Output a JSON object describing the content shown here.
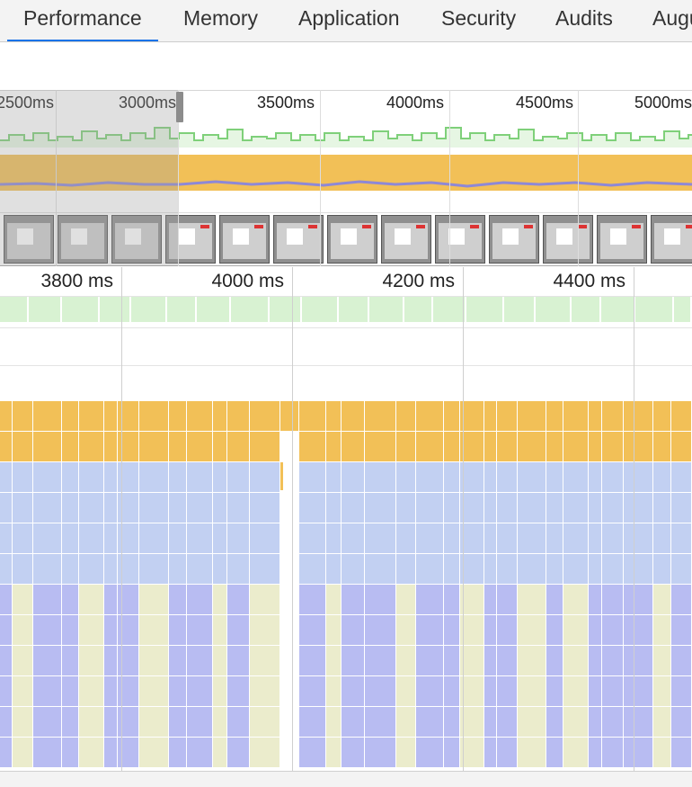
{
  "tabs": [
    {
      "label": "Performance",
      "active": true
    },
    {
      "label": "Memory"
    },
    {
      "label": "Application"
    },
    {
      "label": "Security"
    },
    {
      "label": "Audits"
    },
    {
      "label": "Augury"
    }
  ],
  "overview": {
    "ticks": [
      "2500ms",
      "3000ms",
      "3500ms",
      "4000ms",
      "4500ms",
      "5000ms"
    ]
  },
  "detail": {
    "ticks": [
      "3800 ms",
      "4000 ms",
      "4200 ms",
      "4400 ms"
    ]
  },
  "colors": {
    "accent": "#1a73e8",
    "fps": "#7fd07a",
    "scripting": "#f2c057",
    "frames": "#d8f2d2",
    "function_call": "#c2d0f2",
    "lavender": "#b8bcf2",
    "cream": "#ebeccc"
  }
}
